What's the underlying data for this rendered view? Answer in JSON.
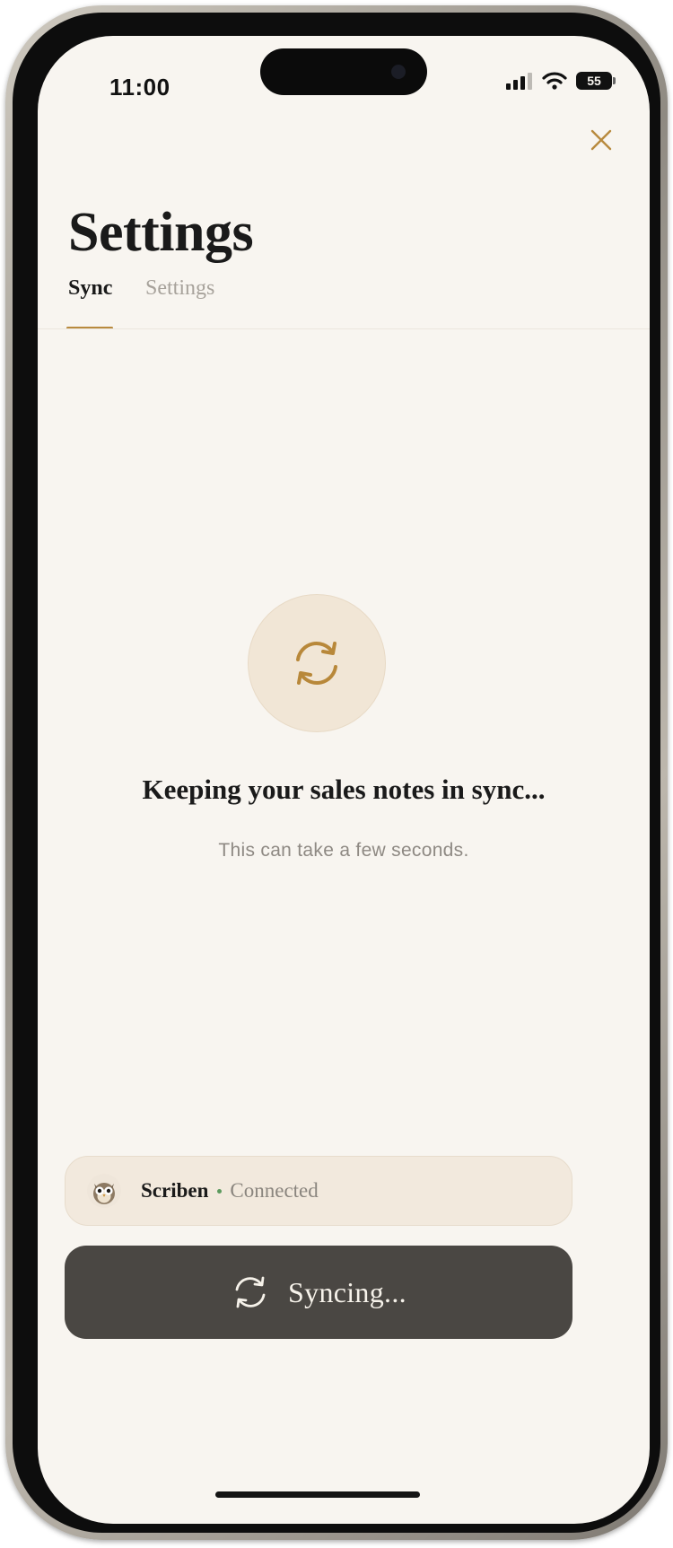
{
  "status_bar": {
    "time": "11:00",
    "battery": "55",
    "icons": [
      "cellular-signal-icon",
      "wifi-icon",
      "battery-icon"
    ]
  },
  "header": {
    "title": "Settings",
    "close_icon": "close-icon"
  },
  "tabs": [
    {
      "label": "Sync",
      "active": true
    },
    {
      "label": "Settings",
      "active": false
    }
  ],
  "sync_state": {
    "icon": "refresh-icon",
    "headline": "Keeping your sales notes in sync...",
    "subtext": "This can take a few seconds."
  },
  "connection": {
    "avatar_icon": "owl-avatar-icon",
    "name": "Scriben",
    "status": "Connected",
    "status_color": "#5c9a5e"
  },
  "action_button": {
    "label": "Syncing...",
    "icon": "refresh-icon"
  },
  "colors": {
    "accent": "#b88a3e",
    "background": "#f8f5f0",
    "button": "#4a4743"
  }
}
